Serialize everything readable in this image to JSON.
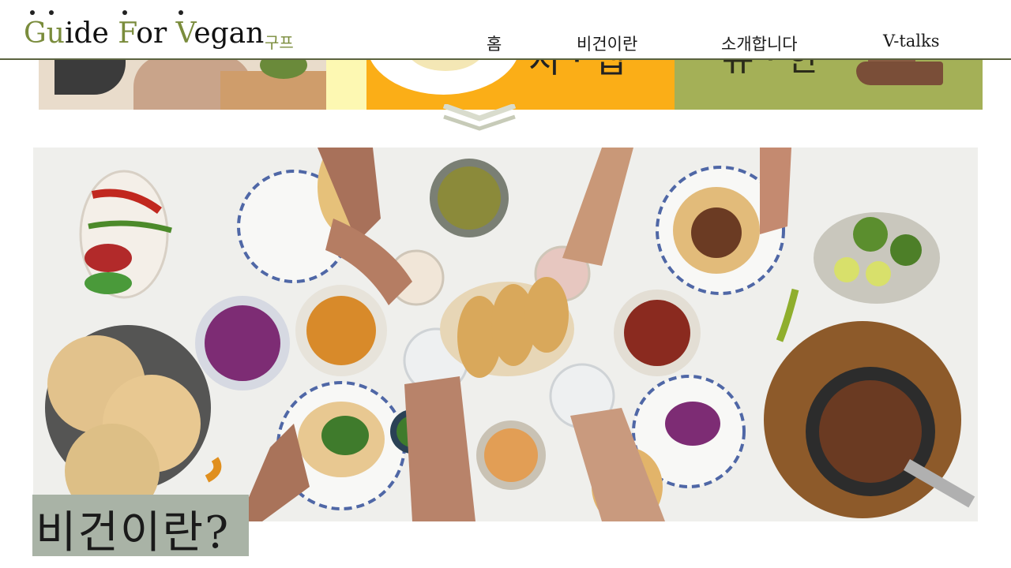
{
  "header": {
    "logo_parts": [
      "G",
      "u",
      "ide ",
      "F",
      "or ",
      "V",
      "egan"
    ],
    "logo_sub": "구프",
    "nav": [
      "홈",
      "비건이란",
      "소개합니다",
      "V-talks"
    ]
  },
  "banner": {
    "panel_b_text": "지 · 앱",
    "panel_c_text": "유 · 한"
  },
  "hero": {
    "title": "비건이란?"
  },
  "colors": {
    "brand_green": "#7a8c3c",
    "header_rule": "#5b6340",
    "title_box": "#a9b3a6",
    "banner_orange": "#fbae17",
    "banner_green": "#a4b057"
  }
}
